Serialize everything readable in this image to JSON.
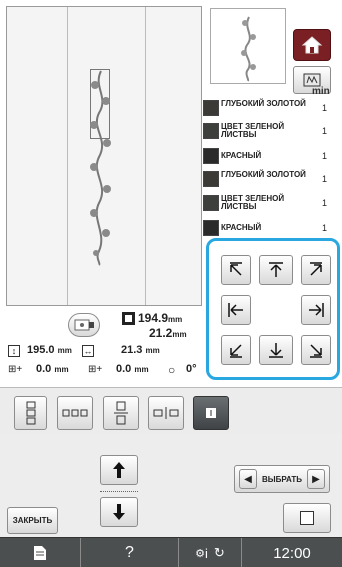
{
  "header": {
    "min_label": "min"
  },
  "color_list": [
    {
      "name": "ГЛУБОКИЙ ЗОЛОТОЙ",
      "count": "1",
      "color": "#3b3a36"
    },
    {
      "name": "ЦВЕТ ЗЕЛЕНОЙ ЛИСТВЫ",
      "count": "1",
      "color": "#3c3f3b"
    },
    {
      "name": "КРАСНЫЙ",
      "count": "1",
      "color": "#2a2a2a"
    },
    {
      "name": "ГЛУБОКИЙ ЗОЛОТОЙ",
      "count": "1",
      "color": "#3b3a36"
    },
    {
      "name": "ЦВЕТ ЗЕЛЕНОЙ ЛИСТВЫ",
      "count": "1",
      "color": "#3c3f3b"
    },
    {
      "name": "КРАСНЫЙ",
      "count": "1",
      "color": "#2a2a2a"
    }
  ],
  "size": {
    "height_value": "194.9",
    "width_value": "21.2",
    "unit": "mm"
  },
  "dims": {
    "total_height": "195.0",
    "total_width": "21.3",
    "unit": "mm"
  },
  "offsets": {
    "x": "0.0",
    "y": "0.0",
    "unit": "mm",
    "angle": "0°"
  },
  "buttons": {
    "close_label": "ЗАКРЫТЬ",
    "select_label": "ВЫБРАТЬ"
  },
  "status_bar": {
    "time": "12:00",
    "help": "?",
    "info": "i"
  },
  "colors": {
    "accent_blue": "#29a7e1",
    "home_red": "#7a1f24",
    "bar_bg": "#4b4f4f"
  }
}
